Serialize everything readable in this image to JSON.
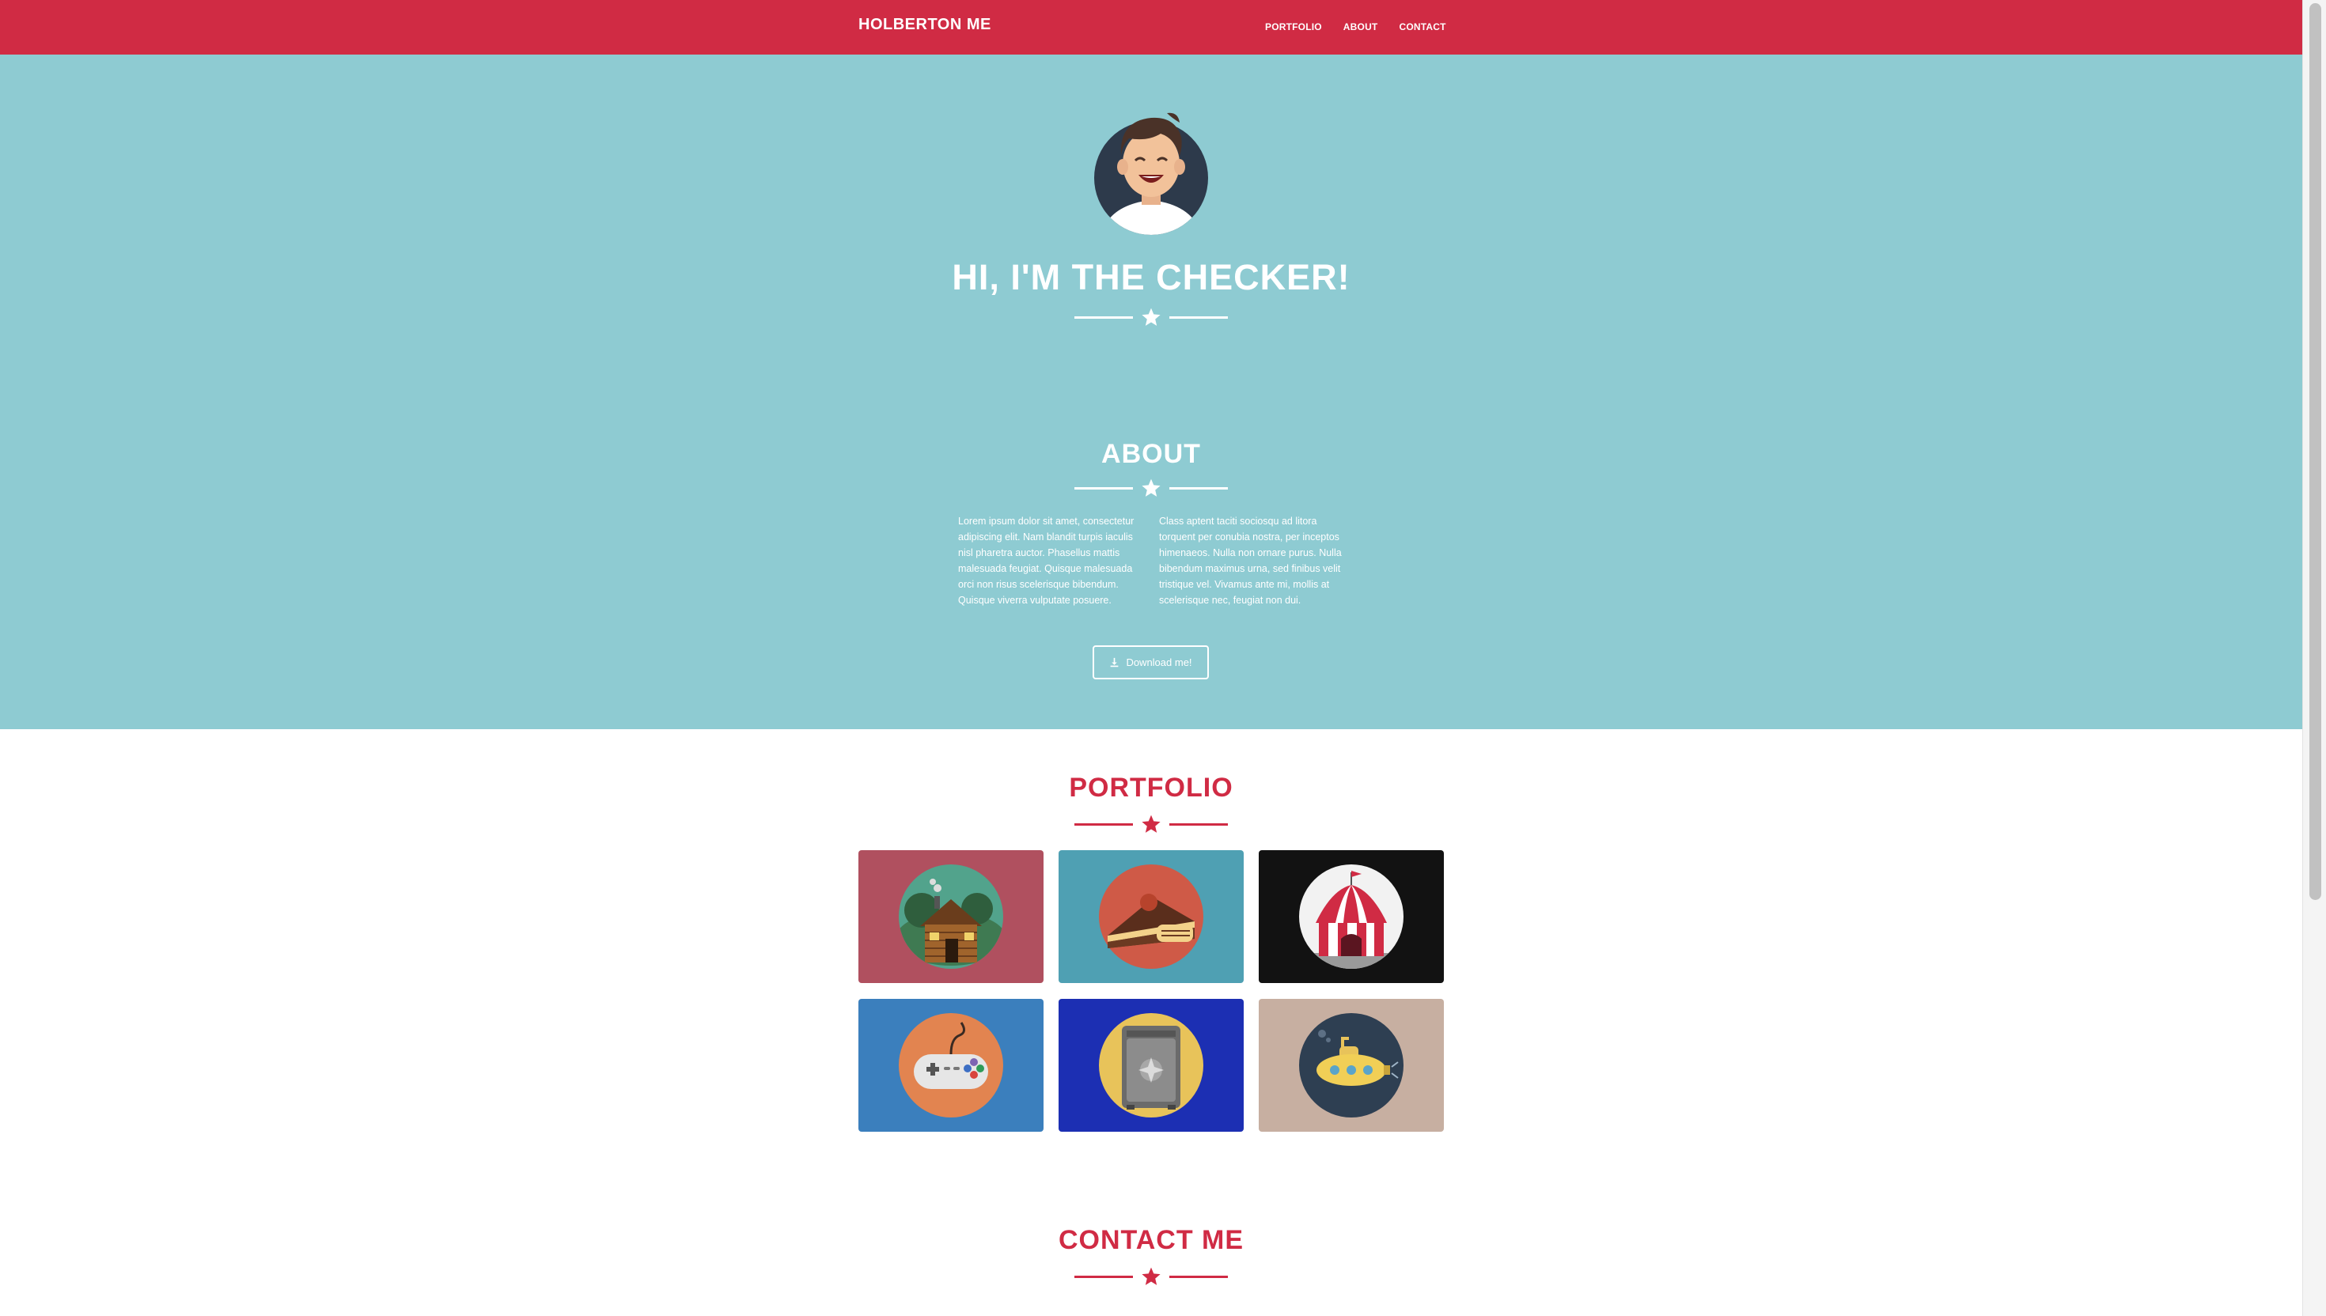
{
  "nav": {
    "brand": "HOLBERTON ME",
    "links": [
      "PORTFOLIO",
      "ABOUT",
      "CONTACT"
    ]
  },
  "hero": {
    "title": "HI, I'M THE CHECKER!"
  },
  "about": {
    "title": "ABOUT",
    "col1": "Lorem ipsum dolor sit amet, consectetur adipiscing elit. Nam blandit turpis iaculis nisl pharetra auctor. Phasellus mattis malesuada feugiat. Quisque malesuada orci non risus scelerisque bibendum. Quisque viverra vulputate posuere.",
    "col2": "Class aptent taciti sociosqu ad litora torquent per conubia nostra, per inceptos himenaeos. Nulla non ornare purus. Nulla bibendum maximus urna, sed finibus velit tristique vel. Vivamus ante mi, mollis at scelerisque nec, feugiat non dui.",
    "button": "Download me!"
  },
  "portfolio": {
    "title": "PORTFOLIO",
    "items": [
      {
        "icon": "cabin-icon",
        "bg": "#b0505f"
      },
      {
        "icon": "cake-icon",
        "bg": "#4fa0b3"
      },
      {
        "icon": "circus-tent-icon",
        "bg": "#121212"
      },
      {
        "icon": "game-controller-icon",
        "bg": "#3b7fbd"
      },
      {
        "icon": "safe-icon",
        "bg": "#1c2fb3"
      },
      {
        "icon": "submarine-icon",
        "bg": "#c7afa1"
      }
    ]
  },
  "contact": {
    "title": "CONTACT ME"
  },
  "colors": {
    "brand_red": "#d02b44",
    "hero_teal": "#8ecbd2"
  }
}
